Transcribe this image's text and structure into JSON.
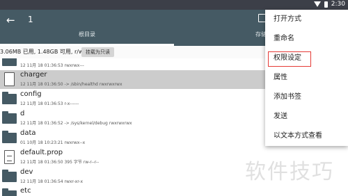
{
  "status_bar": {
    "time": "2:30"
  },
  "app_bar": {
    "title": "1",
    "tabs": [
      "根目录",
      "存储"
    ]
  },
  "storage": {
    "usage_text": "3.06MB 已用, 1.48GB 可用, r/w",
    "mount_button": "挂载为只读"
  },
  "files": [
    {
      "name": "",
      "meta": "12 11月 18 01:36:53  rwxrwx---",
      "type": "folder"
    },
    {
      "name": "charger",
      "meta": "12 11月 18 01:36:50  -> /sbin/healthd  rwxrwxrwx",
      "type": "file"
    },
    {
      "name": "config",
      "meta": "12 11月 18 01:36:53  r-x------",
      "type": "folder"
    },
    {
      "name": "d",
      "meta": "12 11月 18 01:36:52  -> /sys/kernel/debug  rwxrwxrwx",
      "type": "folder"
    },
    {
      "name": "data",
      "meta": "01 10月 18 10:23:21  rwxrwx--x",
      "type": "folder"
    },
    {
      "name": "default.prop",
      "meta": "12 11月 18 01:36:50  395 字节  rw-r--r--",
      "type": "prop"
    },
    {
      "name": "dev",
      "meta": "12 11月 18 01:36:54  rwxr-xr-x",
      "type": "folder"
    },
    {
      "name": "etc",
      "meta": "",
      "type": "folder"
    }
  ],
  "context_menu": {
    "items": [
      "打开方式",
      "重命名",
      "权限设定",
      "属性",
      "添加书签",
      "发送",
      "以文本方式查看"
    ],
    "highlighted_index": 2
  },
  "watermark": "软件技巧"
}
